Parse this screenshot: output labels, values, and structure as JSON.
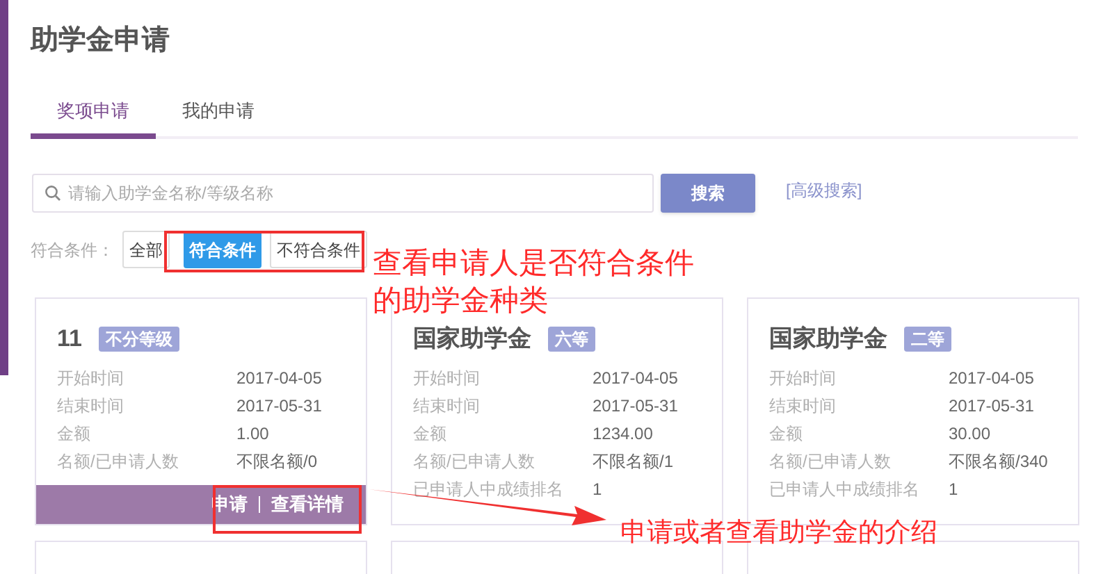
{
  "title": "助学金申请",
  "tabs": [
    {
      "label": "奖项申请",
      "selected": true
    },
    {
      "label": "我的申请",
      "selected": false
    }
  ],
  "search": {
    "placeholder": "请输入助学金名称/等级名称",
    "button": "搜索",
    "advanced_link": "[高级搜索]"
  },
  "filter": {
    "label": "符合条件：",
    "options": [
      {
        "label": "全部",
        "selected": false
      },
      {
        "label": "符合条件",
        "selected": true
      },
      {
        "label": "不符合条件",
        "selected": false
      }
    ]
  },
  "cards": [
    {
      "name": "11",
      "grade": "不分等级",
      "fields": [
        {
          "label": "开始时间",
          "value": "2017-04-05"
        },
        {
          "label": "结束时间",
          "value": "2017-05-31"
        },
        {
          "label": "金额",
          "value": "1.00"
        },
        {
          "label": "名额/已申请人数",
          "value": "不限名额/0"
        }
      ],
      "actions": [
        "申请",
        "查看详情"
      ]
    },
    {
      "name": "国家助学金",
      "grade": "六等",
      "fields": [
        {
          "label": "开始时间",
          "value": "2017-04-05"
        },
        {
          "label": "结束时间",
          "value": "2017-05-31"
        },
        {
          "label": "金额",
          "value": "1234.00"
        },
        {
          "label": "名额/已申请人数",
          "value": "不限名额/1"
        },
        {
          "label": "已申请人中成绩排名",
          "value": "1"
        }
      ]
    },
    {
      "name": "国家助学金",
      "grade": "二等",
      "fields": [
        {
          "label": "开始时间",
          "value": "2017-04-05"
        },
        {
          "label": "结束时间",
          "value": "2017-05-31"
        },
        {
          "label": "金额",
          "value": "30.00"
        },
        {
          "label": "名额/已申请人数",
          "value": "不限名额/340"
        },
        {
          "label": "已申请人中成绩排名",
          "value": "1"
        }
      ]
    }
  ],
  "annotations": [
    {
      "text": "查看申请人是否符合条件的助学金种类"
    },
    {
      "text": "申请或者查看助学金的介绍"
    }
  ]
}
